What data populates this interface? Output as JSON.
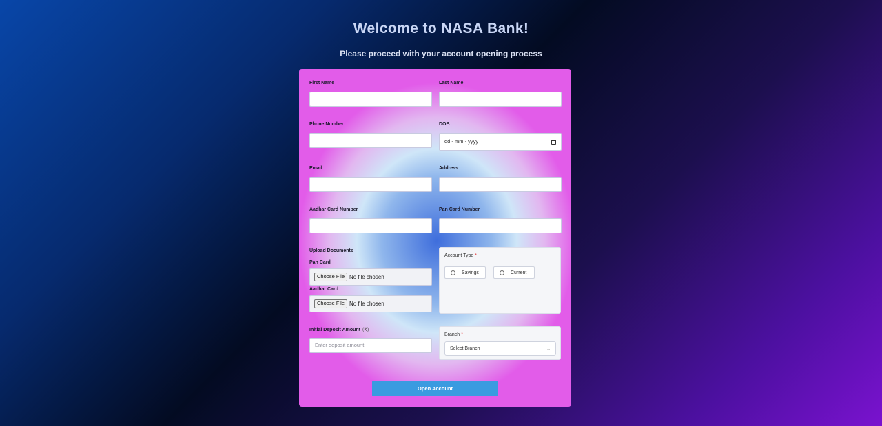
{
  "header": {
    "title": "Welcome to NASA Bank!",
    "subtitle": "Please proceed with your account opening process"
  },
  "form": {
    "first_name": {
      "label": "First Name",
      "value": ""
    },
    "last_name": {
      "label": "Last Name",
      "value": ""
    },
    "phone": {
      "label": "Phone Number",
      "value": ""
    },
    "dob": {
      "label": "DOB",
      "placeholder": "dd - mm - yyyy",
      "icon": "calendar-icon"
    },
    "email": {
      "label": "Email",
      "value": ""
    },
    "address": {
      "label": "Address",
      "value": ""
    },
    "aadhar_number": {
      "label": "Aadhar Card Number",
      "value": ""
    },
    "pan_number": {
      "label": "Pan Card Number",
      "value": ""
    },
    "upload": {
      "heading": "Upload Documents",
      "pan_card": {
        "label": "Pan Card",
        "button": "Choose File",
        "status": "No file chosen"
      },
      "aadhar_card": {
        "label": "Aadhar Card",
        "button": "Choose File",
        "status": "No file chosen"
      }
    },
    "account_type": {
      "label": "Account Type",
      "required_mark": "*",
      "options": [
        "Savings",
        "Current"
      ]
    },
    "deposit": {
      "label": "Initial Deposit Amount",
      "currency": "(₹)",
      "placeholder": "Enter deposit amount"
    },
    "branch": {
      "label": "Branch",
      "required_mark": "*",
      "selected": "Select Branch"
    },
    "submit_label": "Open Account"
  }
}
